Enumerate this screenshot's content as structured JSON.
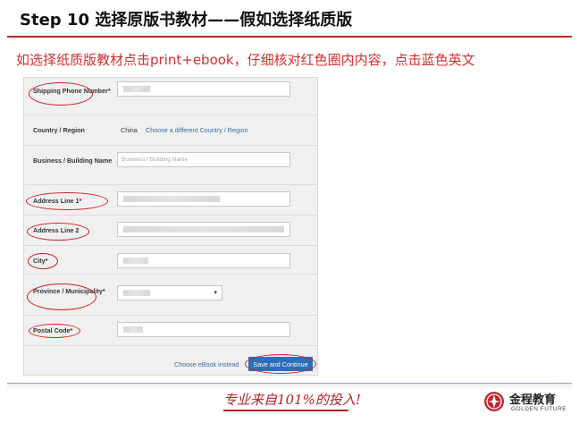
{
  "slide": {
    "title": "Step 10 选择原版书教材——假如选择纸质版",
    "instruction": "如选择纸质版教材点击print+ebook，仔细核对红色圈内内容，点击蓝色英文"
  },
  "form": {
    "shipping_phone": {
      "label": "Shipping Phone Number*",
      "value": ""
    },
    "country": {
      "label": "Country / Region",
      "value": "China",
      "change_link": "Choose a different Country / Region"
    },
    "business": {
      "label": "Business / Building Name",
      "placeholder": "Business / Building Name"
    },
    "address1": {
      "label": "Address Line 1*"
    },
    "address2": {
      "label": "Address Line 2"
    },
    "city": {
      "label": "City*"
    },
    "province": {
      "label": "Province / Municipality*",
      "arrow": "▾"
    },
    "postal": {
      "label": "Postal Code*"
    },
    "ebook_link": "Choose eBook instead",
    "save_button": "Save and Continue"
  },
  "footer": {
    "slogan": "专业来自101%的投入!",
    "brand_name": "金程教育",
    "brand_sub": "GOLDEN FUTURE"
  },
  "colors": {
    "accent_red": "#c0262c",
    "instruction_red": "#d32f2f",
    "link_blue": "#3a6ea5",
    "button_blue": "#2c6eb8"
  }
}
